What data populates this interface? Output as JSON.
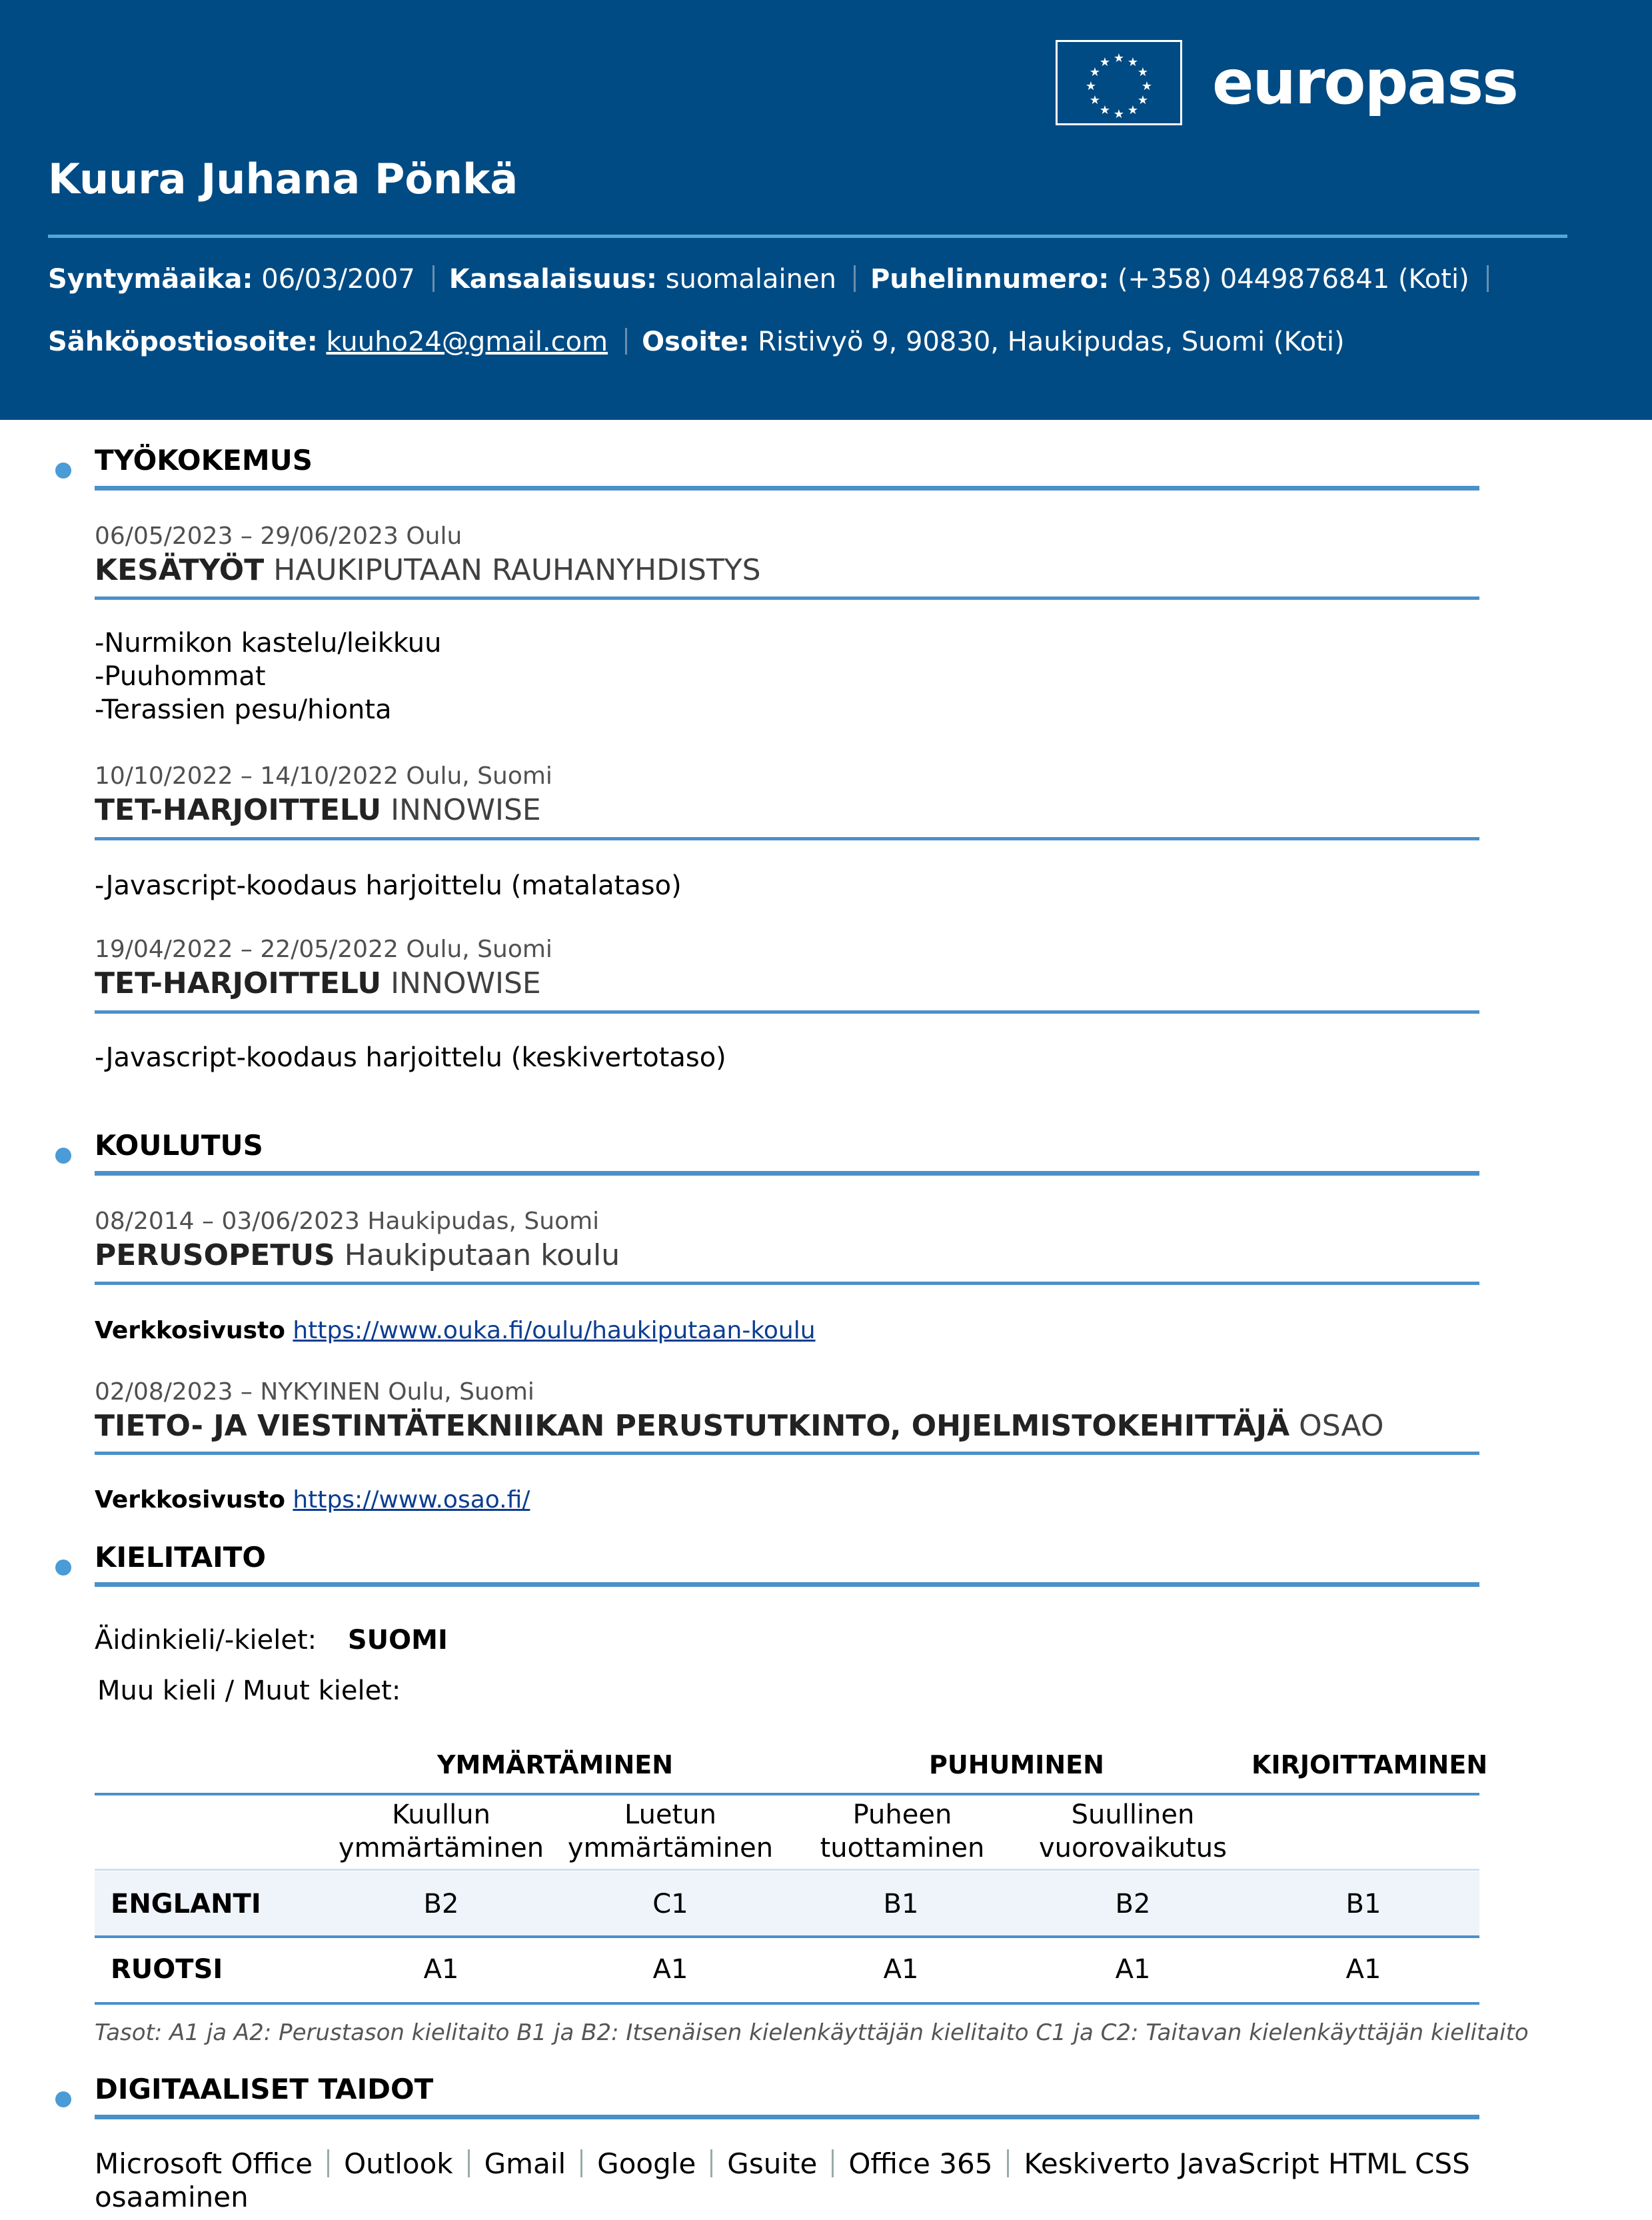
{
  "header": {
    "brand": "europass",
    "name": "Kuura Juhana Pönkä",
    "birth_label": "Syntymäaika:",
    "birth_value": "06/03/2007",
    "nationality_label": "Kansalaisuus:",
    "nationality_value": "suomalainen",
    "phone_label": "Puhelinnumero:",
    "phone_value": "(+358) 0449876841 (Koti)",
    "email_label": "Sähköpostiosoite:",
    "email_value": "kuuho24@gmail.com",
    "address_label": "Osoite:",
    "address_value": "Ristivyö 9, 90830, Haukipudas, Suomi (Koti)"
  },
  "work": {
    "title": "TYÖKOKEMUS",
    "items": [
      {
        "date": "06/05/2023 – 29/06/2023 Oulu",
        "role": "KESÄTYÖT",
        "org": "HAUKIPUTAAN RAUHANYHDISTYS",
        "lines": [
          "-Nurmikon kastelu/leikkuu",
          "-Puuhommat",
          "-Terassien pesu/hionta"
        ]
      },
      {
        "date": "10/10/2022 – 14/10/2022 Oulu, Suomi",
        "role": "TET-HARJOITTELU",
        "org": "INNOWISE",
        "lines": [
          "-Javascript-koodaus harjoittelu (matalataso)"
        ]
      },
      {
        "date": "19/04/2022 – 22/05/2022 Oulu, Suomi",
        "role": "TET-HARJOITTELU",
        "org": "INNOWISE",
        "lines": [
          "-Javascript-koodaus harjoittelu (keskivertotaso)"
        ]
      }
    ]
  },
  "education": {
    "title": "KOULUTUS",
    "items": [
      {
        "date": "08/2014 – 03/06/2023 Haukipudas, Suomi",
        "role": "PERUSOPETUS",
        "org": "Haukiputaan koulu",
        "web_label": "Verkkosivusto",
        "web_url": "https://www.ouka.fi/oulu/haukiputaan-koulu"
      },
      {
        "date": "02/08/2023 – NYKYINEN Oulu, Suomi",
        "role": "TIETO- JA VIESTINTÄTEKNIIKAN PERUSTUTKINTO, OHJELMISTOKEHITTÄJÄ",
        "org": "OSAO",
        "web_label": "Verkkosivusto",
        "web_url": "https://www.osao.fi/"
      }
    ]
  },
  "languages": {
    "title": "KIELITAITO",
    "mother_label": "Äidinkieli/-kielet:",
    "mother_value": "SUOMI",
    "other_label": "Muu kieli / Muut kielet:",
    "groups": [
      "YMMÄRTÄMINEN",
      "PUHUMINEN",
      "KIRJOITTAMINEN"
    ],
    "subheads": [
      "Kuullun ymmärtäminen",
      "Luetun ymmärtäminen",
      "Puheen tuottaminen",
      "Suullinen vuorovaikutus"
    ],
    "rows": [
      {
        "name": "ENGLANTI",
        "levels": [
          "B2",
          "C1",
          "B1",
          "B2",
          "B1"
        ]
      },
      {
        "name": "RUOTSI",
        "levels": [
          "A1",
          "A1",
          "A1",
          "A1",
          "A1"
        ]
      }
    ],
    "note": "Tasot: A1 ja A2: Perustason kielitaito B1 ja B2: Itsenäisen kielenkäyttäjän kielitaito C1 ja C2: Taitavan kielenkäyttäjän kielitaito"
  },
  "digital": {
    "title": "DIGITAALISET TAIDOT",
    "skills": [
      "Microsoft Office",
      "Outlook",
      "Gmail",
      "Google",
      "Gsuite",
      "Office 365",
      "Keskiverto JavaScript HTML CSS"
    ],
    "wrap": "osaaminen"
  },
  "colors": {
    "header_bg": "#004b84",
    "accent": "#4a90c9"
  }
}
